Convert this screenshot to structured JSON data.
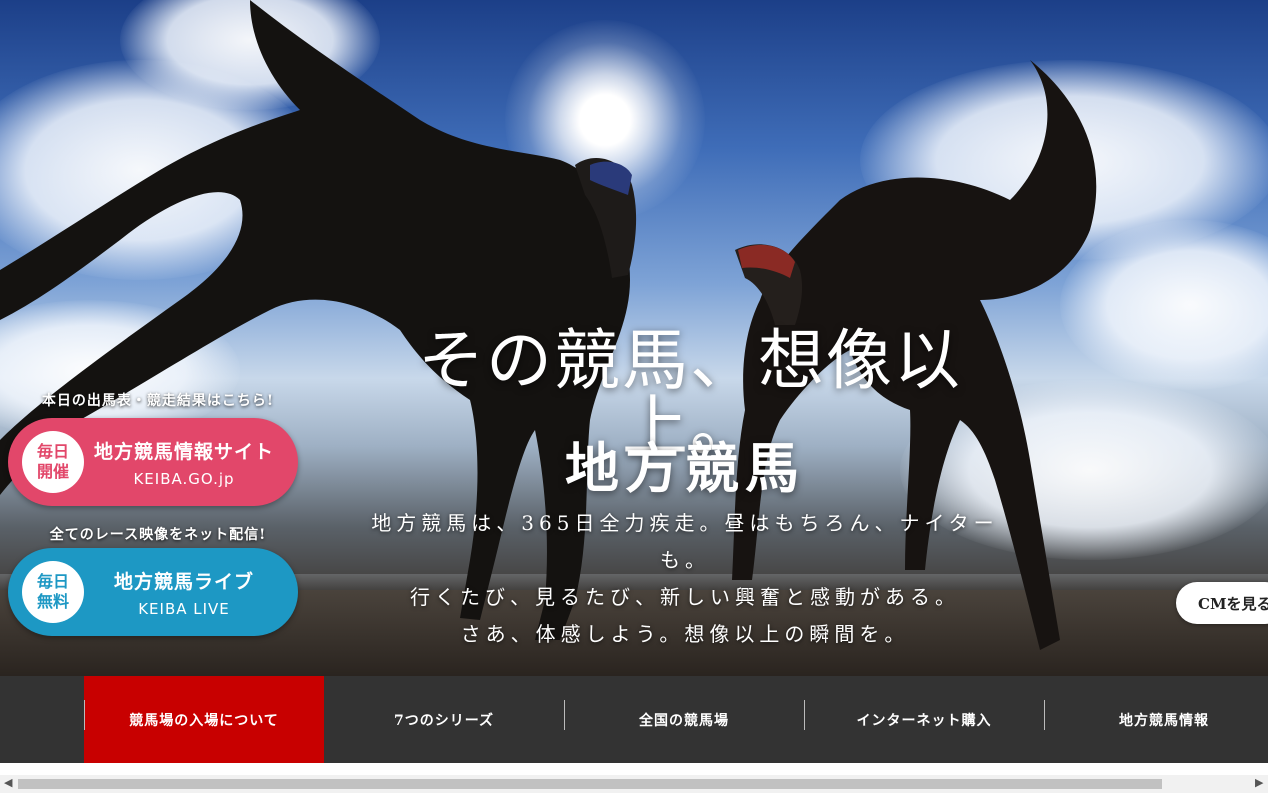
{
  "hero": {
    "catchcopy": "その競馬、想像以上。",
    "title": "地方競馬",
    "lead": [
      "地方競馬は、365日全力疾走。昼はもちろん、ナイターも。",
      "行くたび、見るたび、新しい興奮と感動がある。",
      "さあ、体感しよう。想像以上の瞬間を。"
    ]
  },
  "banners": {
    "keiba": {
      "caption": "本日の出馬表・競走結果はこちら!",
      "badge_line1": "毎日",
      "badge_line2": "開催",
      "name": "地方競馬情報サイト",
      "en": "KEIBA.GO.jp",
      "color": "#e2476a"
    },
    "live": {
      "caption": "全てのレース映像をネット配信!",
      "badge_line1": "毎日",
      "badge_line2": "無料",
      "name": "地方競馬ライブ",
      "en": "KEIBA LIVE",
      "color": "#1d98c4"
    }
  },
  "cm_button": {
    "label": "CMを見る"
  },
  "nav": {
    "active_color": "#c80000",
    "items": [
      {
        "label": "競馬場の入場について"
      },
      {
        "label": "7つのシリーズ"
      },
      {
        "label": "全国の競馬場"
      },
      {
        "label": "インターネット購入"
      },
      {
        "label": "地方競馬情報"
      }
    ]
  },
  "scrollbar": {
    "left_arrow_icon": "◀",
    "right_arrow_icon": "▶"
  }
}
